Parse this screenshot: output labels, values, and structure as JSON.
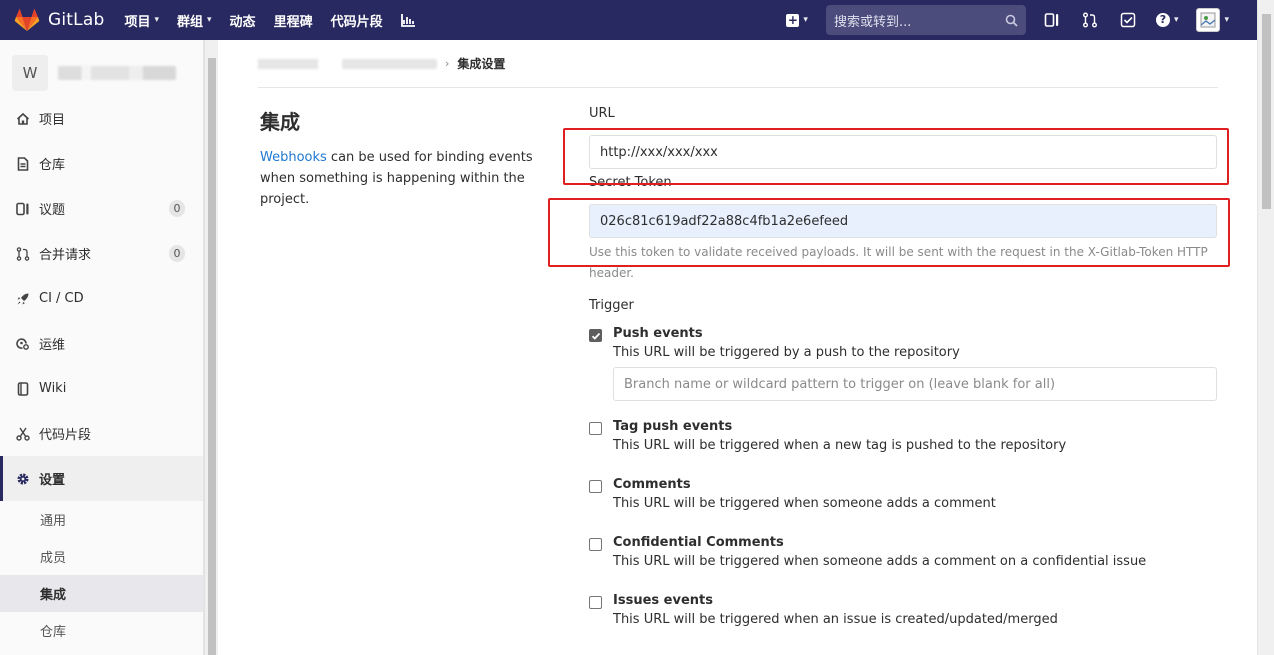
{
  "navbar": {
    "brand": "GitLab",
    "items": [
      {
        "label": "项目",
        "has_caret": true
      },
      {
        "label": "群组",
        "has_caret": true
      },
      {
        "label": "动态",
        "has_caret": false
      },
      {
        "label": "里程碑",
        "has_caret": false
      },
      {
        "label": "代码片段",
        "has_caret": false
      }
    ],
    "search_placeholder": "搜索或转到...",
    "bg_color": "#292961"
  },
  "sidebar": {
    "project_initial": "W",
    "items": [
      {
        "label": "项目",
        "icon": "home-icon"
      },
      {
        "label": "仓库",
        "icon": "doc-icon"
      },
      {
        "label": "议题",
        "icon": "issues-icon",
        "badge": "0"
      },
      {
        "label": "合并请求",
        "icon": "merge-request-icon",
        "badge": "0"
      },
      {
        "label": "CI / CD",
        "icon": "rocket-icon"
      },
      {
        "label": "运维",
        "icon": "operations-icon"
      },
      {
        "label": "Wiki",
        "icon": "book-icon"
      },
      {
        "label": "代码片段",
        "icon": "snippet-icon"
      },
      {
        "label": "设置",
        "icon": "settings-icon",
        "active": true
      }
    ],
    "sub_items": [
      {
        "label": "通用"
      },
      {
        "label": "成员"
      },
      {
        "label": "集成",
        "active": true
      },
      {
        "label": "仓库"
      }
    ]
  },
  "breadcrumb": {
    "current": "集成设置"
  },
  "page": {
    "title": "集成",
    "desc_link": "Webhooks",
    "desc_rest": " can be used for binding events when something is happening within the project."
  },
  "form": {
    "url_label": "URL",
    "url_value": "http://xxx/xxx/xxx",
    "token_label": "Secret Token",
    "token_value": "026c81c619adf22a88c4fb1a2e6efeed",
    "token_help": "Use this token to validate received payloads. It will be sent with the request in the X-Gitlab-Token HTTP header.",
    "trigger_label": "Trigger",
    "push_title": "Push events",
    "push_desc": "This URL will be triggered by a push to the repository",
    "branch_placeholder": "Branch name or wildcard pattern to trigger on (leave blank for all)",
    "triggers": [
      {
        "title": "Tag push events",
        "desc": "This URL will be triggered when a new tag is pushed to the repository",
        "checked": false
      },
      {
        "title": "Comments",
        "desc": "This URL will be triggered when someone adds a comment",
        "checked": false
      },
      {
        "title": "Confidential Comments",
        "desc": "This URL will be triggered when someone adds a comment on a confidential issue",
        "checked": false
      },
      {
        "title": "Issues events",
        "desc": "This URL will be triggered when an issue is created/updated/merged",
        "checked": false
      }
    ],
    "push_checked": true
  },
  "highlight_color": "#e02020"
}
